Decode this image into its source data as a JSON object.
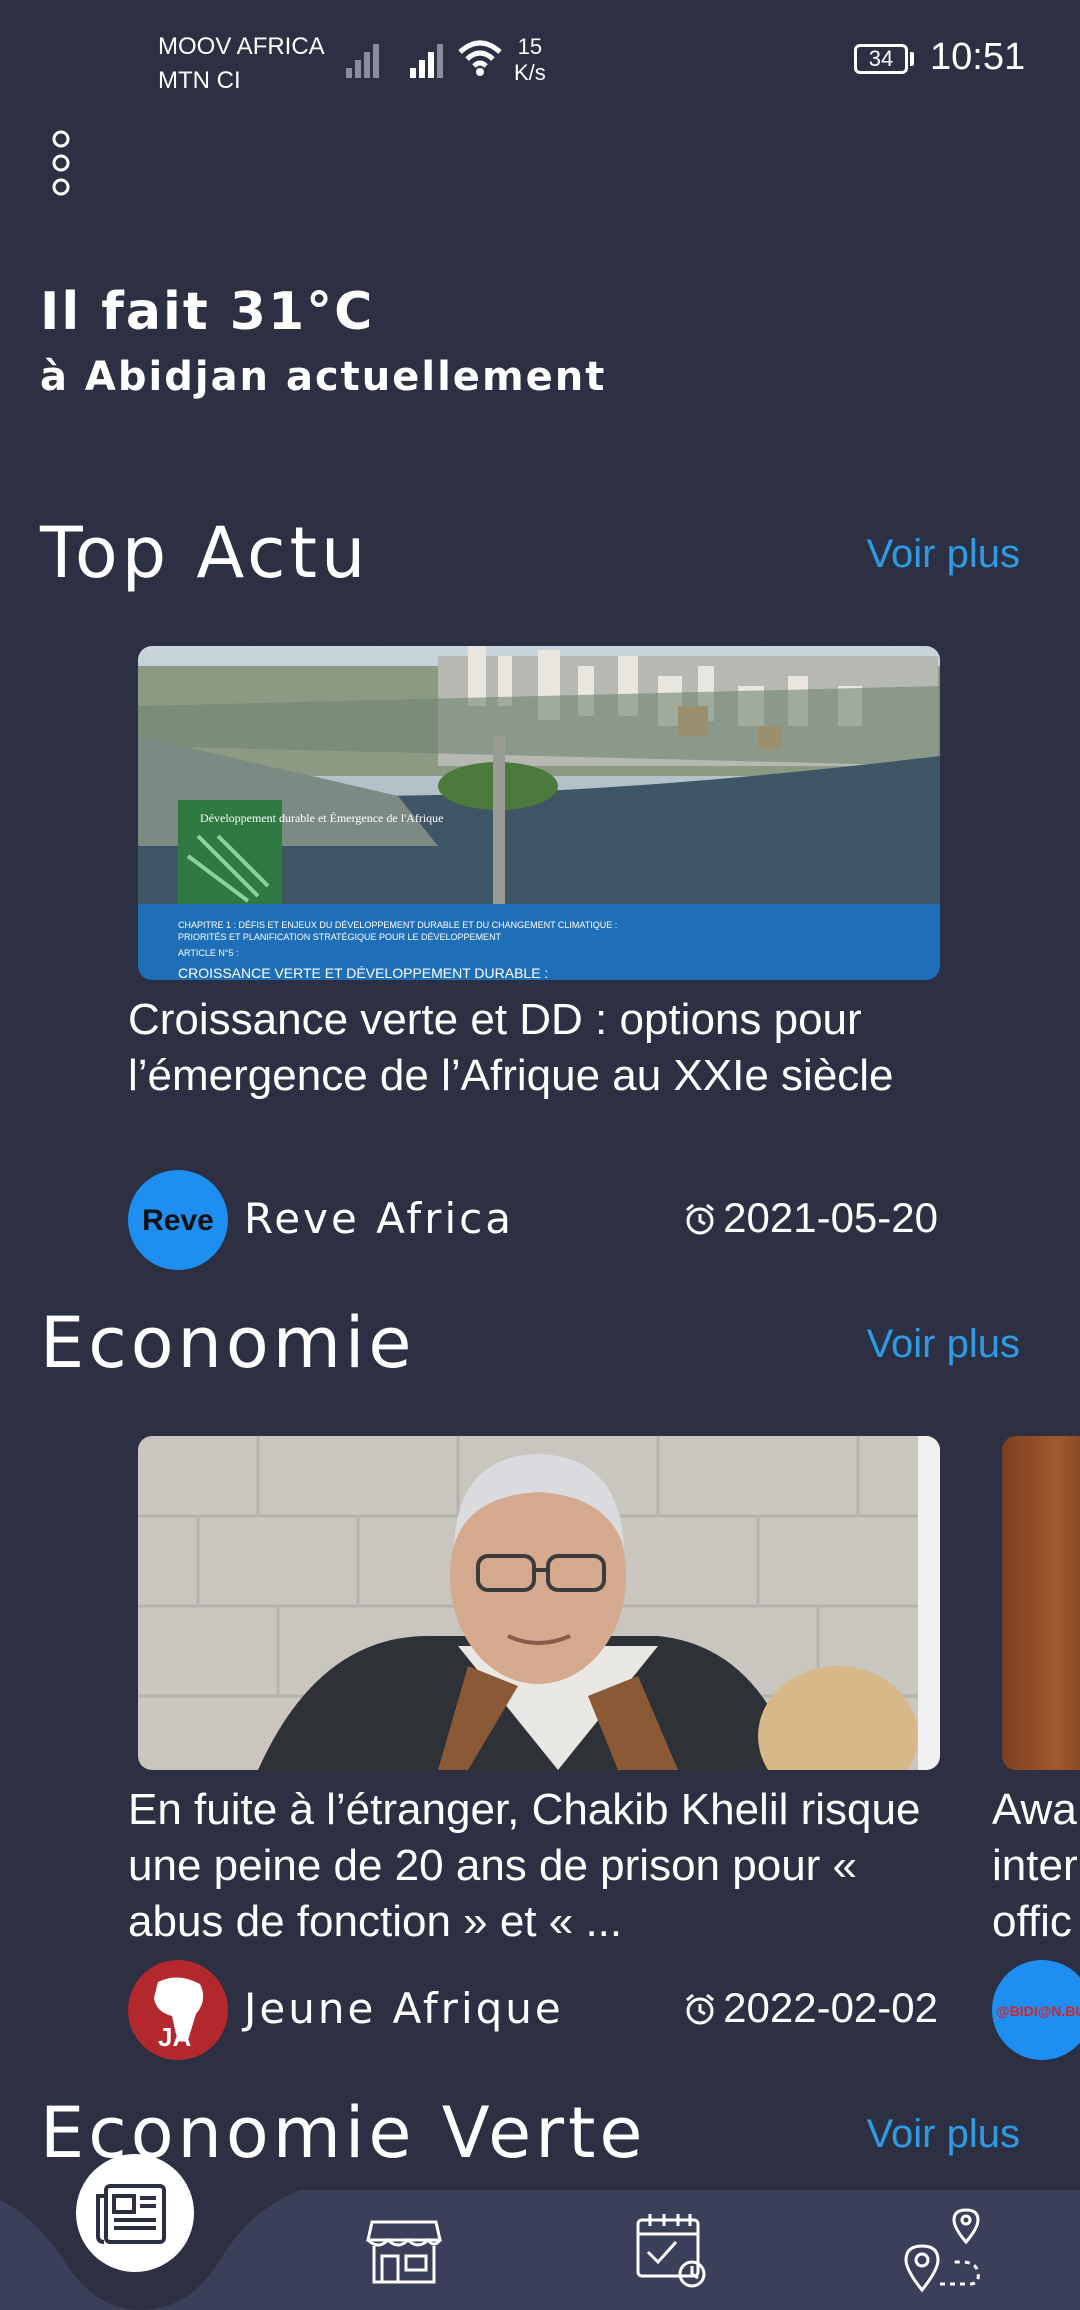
{
  "status_bar": {
    "carrier1": "MOOV AFRICA",
    "carrier2": "MTN CI",
    "speed_value": "15",
    "speed_unit": "K/s",
    "battery": "34",
    "time": "10:51"
  },
  "weather": {
    "line1": "Il fait 31°C",
    "line2": "à Abidjan actuellement"
  },
  "sections": [
    {
      "title": "Top Actu",
      "more": "Voir plus",
      "card": {
        "title": "Croissance verte et DD : options pour l’émergence de l’Afrique au XXIe siècle",
        "source": "Reve Africa",
        "logo_text": "Reve",
        "date": "2021-05-20",
        "image_caption_line1": "CHAPITRE 1 : DÉFIS ET ENJEUX DU DÉVELOPPEMENT DURABLE ET DU CHANGEMENT CLIMATIQUE :",
        "image_caption_line2": "PRIORITÉS ET PLANIFICATION STRATÉGIQUE POUR LE DÉVELOPPEMENT",
        "image_caption_line3": "ARTICLE N°5 :",
        "image_caption_line4": "CROISSANCE VERTE ET DÉVELOPPEMENT DURABLE :",
        "book_title": "Développement durable et Émergence de l'Afrique"
      }
    },
    {
      "title": "Economie",
      "more": "Voir plus",
      "card": {
        "title": "En fuite à l’étranger, Chakib Khelil risque une peine de 20 ans de prison pour « abus de fonction » et « ...",
        "source": "Jeune Afrique",
        "logo_text": "JA",
        "date": "2022-02-02"
      },
      "peek": {
        "title_fragment": "Awa inter offic",
        "logo_text": "@BIDI@N.BU"
      }
    },
    {
      "title": "Economie Verte",
      "more": "Voir plus"
    }
  ],
  "colors": {
    "background": "#2c3042",
    "accent": "#2e9be6",
    "nav_bar": "#3b3f5a"
  },
  "nav": {
    "items": [
      "newspaper-icon",
      "store-icon",
      "calendar-check-icon",
      "route-map-icon"
    ]
  }
}
